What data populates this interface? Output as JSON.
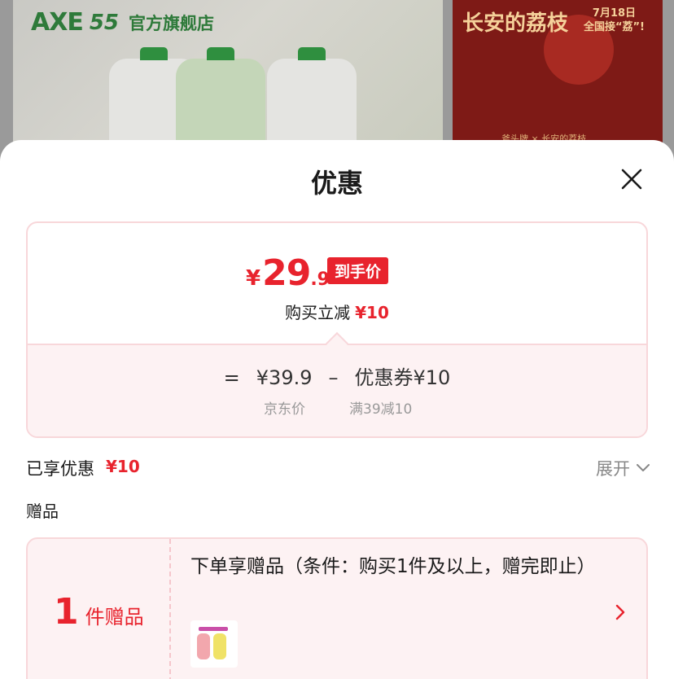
{
  "background": {
    "store_brand": "AXE",
    "store_anniversary": "55",
    "store_name": "官方旗舰店",
    "banner_title": "长安的荔枝",
    "banner_date": "7月18日",
    "banner_date_sub": "全国接“荔”!",
    "banner_footer": "斧头牌 × 长安的荔枝"
  },
  "sheet": {
    "title": "优惠",
    "close_icon": "close-icon"
  },
  "price_card": {
    "currency_symbol": "¥",
    "final_price_int": "29",
    "final_price_dec": ".9",
    "final_price_tag": "到手价",
    "instant_label": "购买立减",
    "instant_amount": "¥10",
    "formula_equals": "=",
    "jd_price": "¥39.9",
    "formula_minus": "–",
    "coupon_label": "优惠券¥10",
    "jd_price_label": "京东价",
    "coupon_condition": "满39减10"
  },
  "enjoyed": {
    "label": "已享优惠",
    "amount": "¥10",
    "expand_label": "展开",
    "expand_icon": "chevron-down-icon"
  },
  "gifts": {
    "heading": "赠品",
    "count": "1",
    "count_unit": "件赠品",
    "description": "下单享赠品（条件：购买1件及以上，赠完即止）",
    "arrow_icon": "chevron-right-icon"
  },
  "colors": {
    "accent_red": "#e8232d",
    "card_border": "#f8d7da",
    "card_tint": "#fdf2f3",
    "muted_text": "#999999"
  }
}
